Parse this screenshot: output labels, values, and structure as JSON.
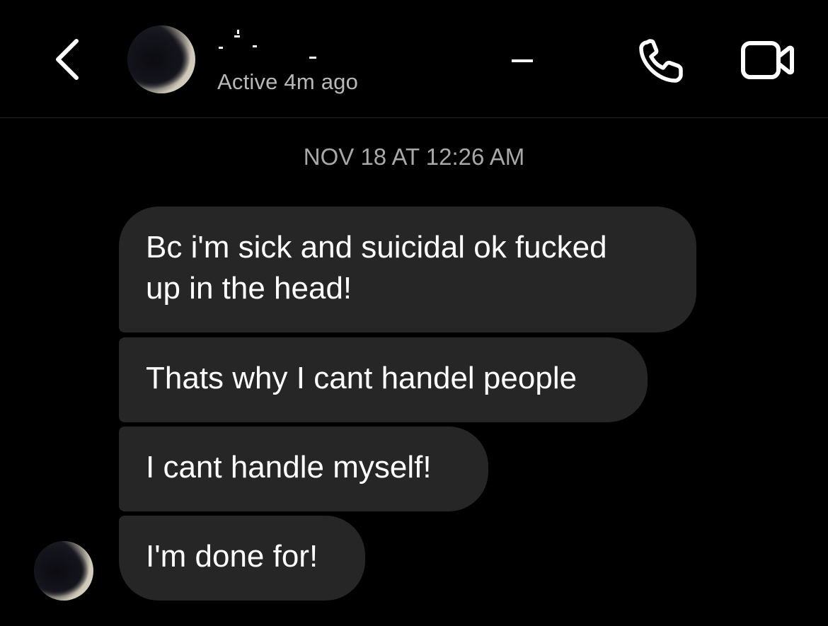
{
  "header": {
    "back_icon": "chevron-left-icon",
    "avatar_icon": "profile-photo",
    "active_status": "Active 4m ago",
    "call_icon": "phone-icon",
    "video_icon": "video-camera-icon"
  },
  "thread": {
    "timestamp": "NOV 18 AT 12:26 AM",
    "messages": [
      {
        "text": "Bc i'm sick and suicidal ok fucked\nup in the head!"
      },
      {
        "text": "Thats why I cant handel people"
      },
      {
        "text": "I cant handle myself!"
      },
      {
        "text": "I'm done for!"
      }
    ]
  },
  "colors": {
    "background": "#000000",
    "bubble": "#262626",
    "text": "#ffffff",
    "muted_text": "#a8a8a8",
    "divider": "#262626"
  }
}
